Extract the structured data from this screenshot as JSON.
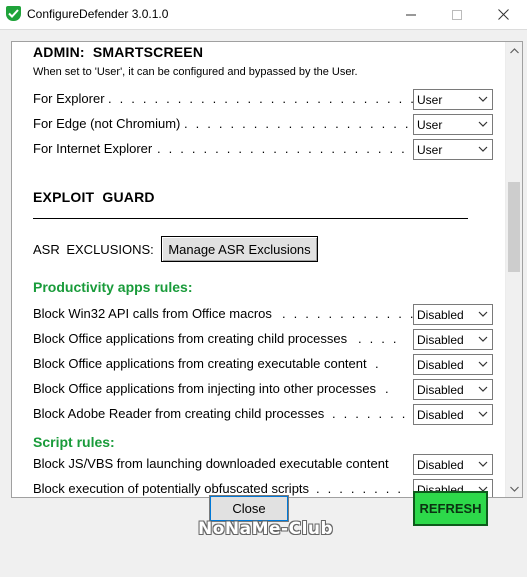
{
  "window": {
    "title": "ConfigureDefender 3.0.1.0",
    "icon": "defender-shield-icon",
    "controls": {
      "minimize": "—",
      "maximize": "☐",
      "close": "✕"
    }
  },
  "admin_smartscreen": {
    "heading": "ADMIN: SMARTSCREEN",
    "note": "When set to 'User', it can be configured and bypassed by the User.",
    "rows": [
      {
        "label": "For Explorer",
        "dots": ". . . . . . . . . . . . . . . . . . . . . . . . . . . . . . . .",
        "value": "User"
      },
      {
        "label": "For Edge (not Chromium)",
        "dots": ". . . . . . . . . . . . . . . . . . . . . . . .",
        "value": "User"
      },
      {
        "label": "For Internet Explorer",
        "dots": ". . . . . . . . . . . . . . . . . . . . . . . . . .",
        "value": "User"
      }
    ]
  },
  "exploit_guard": {
    "heading": "EXPLOIT GUARD",
    "asr_label": "ASR EXCLUSIONS:",
    "asr_button": "Manage ASR Exclusions"
  },
  "productivity": {
    "heading": "Productivity apps rules:",
    "rows": [
      {
        "label": "Block Win32 API calls from Office macros",
        "dots": ". . . . . . . . . . . . .",
        "value": "Disabled"
      },
      {
        "label": "Block Office applications from creating child processes",
        "dots": ". . . .",
        "value": "Disabled"
      },
      {
        "label": "Block Office applications from creating executable content",
        "dots": ".",
        "value": "Disabled"
      },
      {
        "label": "Block Office applications from injecting into other processes",
        "dots": ".",
        "value": "Disabled"
      },
      {
        "label": "Block Adobe Reader from creating child processes",
        "dots": ". . . . . . . .",
        "value": "Disabled"
      }
    ]
  },
  "script": {
    "heading": "Script rules:",
    "rows": [
      {
        "label": "Block JS/VBS from launching downloaded executable content",
        "dots": "",
        "value": "Disabled"
      },
      {
        "label": "Block execution of potentially obfuscated scripts",
        "dots": ". . . . . . . .",
        "value": "Disabled"
      }
    ]
  },
  "footer": {
    "close_label": "Close",
    "refresh_label": "REFRESH",
    "watermark": "NoNaMe-Club"
  },
  "colors": {
    "green_heading": "#199b3a",
    "refresh_bg": "#2dd94a",
    "icon_green": "#1fa33a"
  }
}
